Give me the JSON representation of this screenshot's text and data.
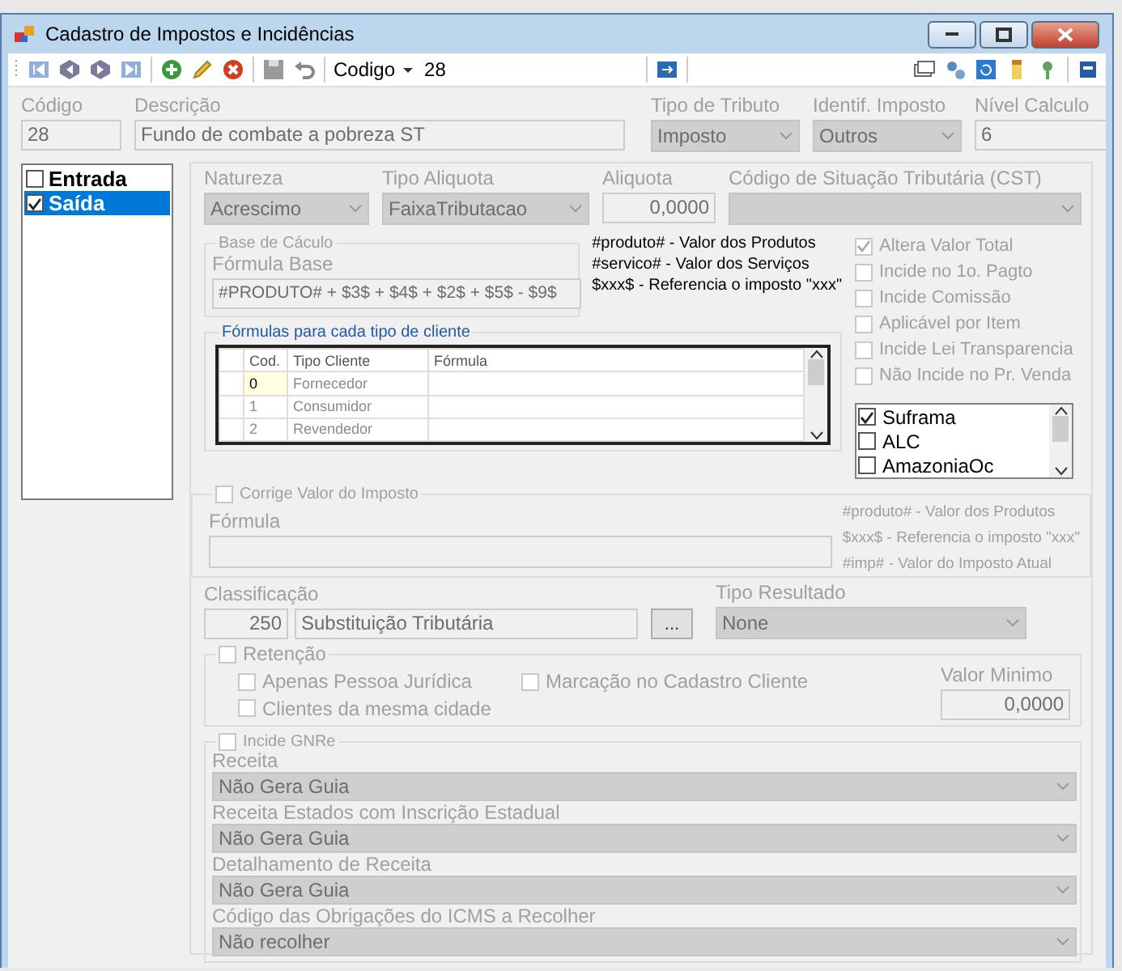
{
  "window": {
    "title": "Cadastro de Impostos e Incidências"
  },
  "toolbar": {
    "search_label": "Codigo",
    "search_value": "28"
  },
  "header": [
    {
      "kind": "text",
      "label": "Código",
      "value": "28"
    },
    {
      "kind": "text",
      "label": "Descrição",
      "value": "Fundo de combate a pobreza ST"
    },
    {
      "kind": "combo",
      "label": "Tipo de Tributo",
      "value": "Imposto"
    },
    {
      "kind": "combo",
      "label": "Identif. Imposto",
      "value": "Outros"
    },
    {
      "kind": "text",
      "label": "Nível Calculo",
      "value": "6"
    }
  ],
  "operations": [
    {
      "label": "Entrada",
      "checked": false,
      "selected": false
    },
    {
      "label": "Saída",
      "checked": true,
      "selected": true
    }
  ],
  "tax_fields": [
    {
      "kind": "combo",
      "label": "Natureza",
      "value": "Acrescimo"
    },
    {
      "kind": "combo",
      "label": "Tipo Aliquota",
      "value": "FaixaTributacao"
    },
    {
      "kind": "number",
      "label": "Aliquota",
      "value": "0,0000"
    },
    {
      "kind": "combo",
      "label": "Código de Situação Tributária (CST)"
    }
  ],
  "base_calculo": {
    "title": "Base de Cáculo",
    "formula_label": "Fórmula Base",
    "formula_value": "#PRODUTO# + $3$ + $4$ + $2$ + $5$ - $9$",
    "hints": [
      "#produto# - Valor dos Produtos",
      "#servico# - Valor dos Serviços",
      "$xxx$ - Referencia o imposto \"xxx\""
    ],
    "client_formulas": {
      "title": "Fórmulas para cada tipo de cliente",
      "columns": [
        "Cod.",
        "Tipo Cliente",
        "Fórmula"
      ],
      "rows": [
        {
          "cod": "0",
          "tipo": "Fornecedor",
          "selected": true
        },
        {
          "cod": "1",
          "tipo": "Consumidor",
          "selected": false
        },
        {
          "cod": "2",
          "tipo": "Revendedor",
          "selected": false
        }
      ]
    }
  },
  "options": [
    {
      "label": "Altera Valor Total",
      "checked": true
    },
    {
      "label": "Incide no 1o. Pagto",
      "checked": false
    },
    {
      "label": "Incide Comissão",
      "checked": false
    },
    {
      "label": "Aplicável por Item",
      "checked": false
    },
    {
      "label": "Incide Lei Transparencia",
      "checked": false
    },
    {
      "label": "Não Incide no Pr. Venda",
      "checked": false
    }
  ],
  "regions": [
    {
      "label": "Suframa",
      "checked": true
    },
    {
      "label": "ALC",
      "checked": false
    },
    {
      "label": "AmazoniaOc",
      "checked": false
    }
  ],
  "corrige": {
    "label": "Corrige Valor do Imposto",
    "checked": false,
    "formula_label": "Fórmula",
    "hints": [
      "#produto# - Valor dos Produtos",
      "$xxx$ - Referencia o imposto \"xxx\"",
      "#imp# - Valor do Imposto Atual"
    ]
  },
  "classificacao": {
    "label": "Classificação",
    "code": "250",
    "description": "Substituição Tributária",
    "button": "..."
  },
  "tipo_resultado": {
    "label": "Tipo Resultado",
    "value": "None"
  },
  "retencao": {
    "label": "Retenção",
    "checked": false,
    "options": [
      {
        "label": "Apenas Pessoa Jurídica",
        "checked": false
      },
      {
        "label": "Marcação no Cadastro Cliente",
        "checked": false
      },
      {
        "label": "Clientes da mesma cidade",
        "checked": false
      }
    ],
    "valor_minimo": {
      "label": "Valor Minimo",
      "value": "0,0000"
    }
  },
  "gnre": {
    "label": "Incide GNRe",
    "checked": false,
    "fields": [
      {
        "label": "Receita",
        "value": "Não Gera Guia"
      },
      {
        "label": "Receita Estados com Inscrição Estadual",
        "value": "Não Gera Guia"
      },
      {
        "label": "Detalhamento de Receita",
        "value": "Não Gera Guia"
      },
      {
        "label": "Código das Obrigações do ICMS a Recolher",
        "value": "Não recolher"
      }
    ]
  }
}
